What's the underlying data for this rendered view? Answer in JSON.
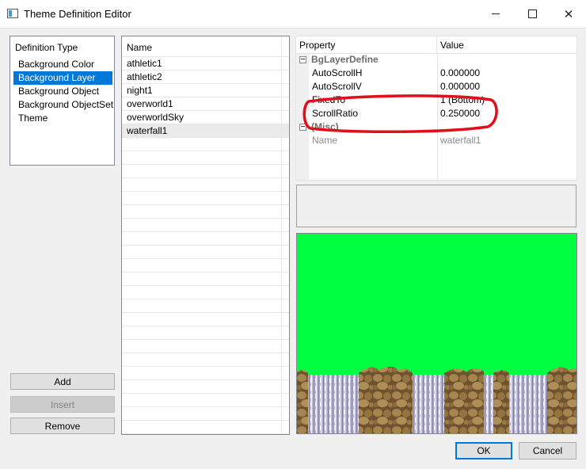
{
  "window": {
    "title": "Theme Definition Editor",
    "minimize_label": "—",
    "close_label": "✕"
  },
  "definition_type": {
    "header": "Definition Type",
    "items": [
      "Background Color",
      "Background Layer",
      "Background Object",
      "Background ObjectSet",
      "Theme"
    ],
    "selected": "Background Layer"
  },
  "names": {
    "header": "Name",
    "items": [
      "athletic1",
      "athletic2",
      "night1",
      "overworld1",
      "overworldSky",
      "waterfall1"
    ],
    "selected": "waterfall1"
  },
  "buttons": {
    "add": "Add",
    "insert": "Insert",
    "remove": "Remove",
    "ok": "OK",
    "cancel": "Cancel"
  },
  "property_grid": {
    "col_property": "Property",
    "col_value": "Value",
    "categories": [
      {
        "name": "BgLayerDefine",
        "expander": "⊟",
        "props": [
          {
            "name": "AutoScrollH",
            "value": "0.000000"
          },
          {
            "name": "AutoScrollV",
            "value": "0.000000"
          },
          {
            "name": "FixedTo",
            "value": "1 (Bottom)"
          },
          {
            "name": "ScrollRatio",
            "value": "0.250000"
          }
        ]
      },
      {
        "name": "(Misc)",
        "expander": "⊟",
        "props": [
          {
            "name": "Name",
            "value": "waterfall1"
          }
        ]
      }
    ]
  },
  "annotation": {
    "color": "#e0101a",
    "target": "ScrollRatio"
  },
  "preview": {
    "sky_color": "#00ff41",
    "ground_color": "#8a6a3c",
    "waterfall_color": "#b8bcd8"
  }
}
